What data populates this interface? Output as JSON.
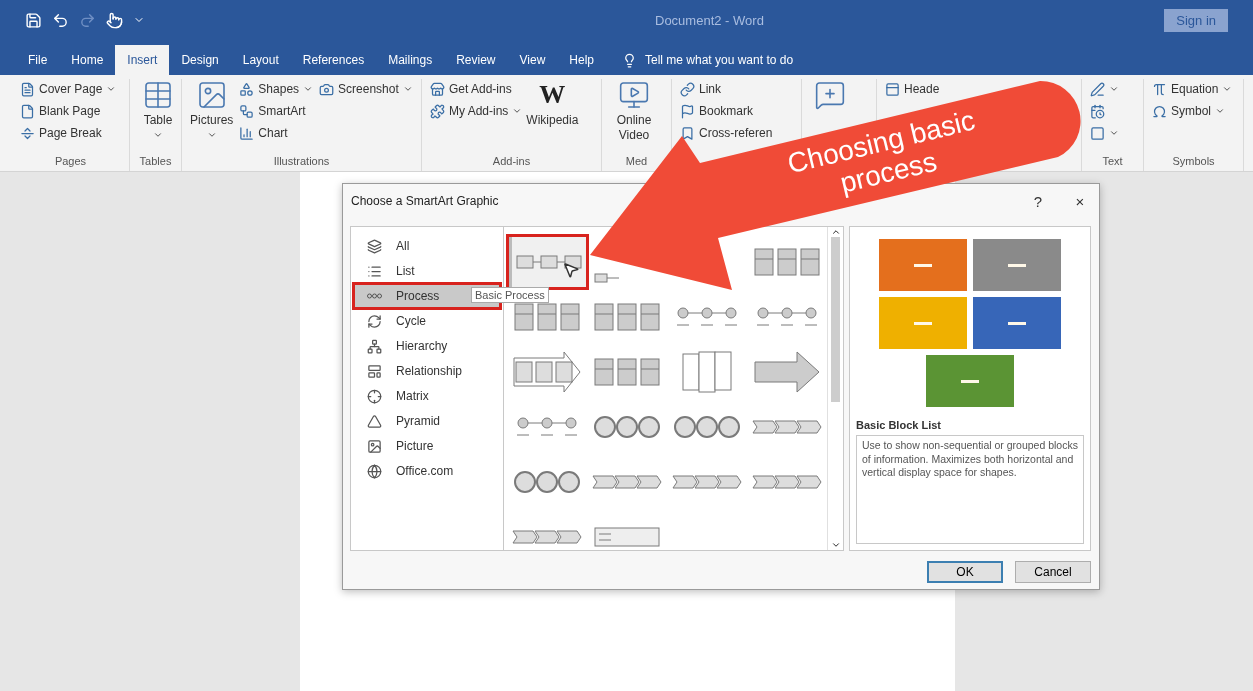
{
  "window": {
    "title": "Document2 - Word",
    "sign_in": "Sign in"
  },
  "tabs": [
    {
      "label": "File",
      "selected": false
    },
    {
      "label": "Home",
      "selected": false
    },
    {
      "label": "Insert",
      "selected": true
    },
    {
      "label": "Design",
      "selected": false
    },
    {
      "label": "Layout",
      "selected": false
    },
    {
      "label": "References",
      "selected": false
    },
    {
      "label": "Mailings",
      "selected": false
    },
    {
      "label": "Review",
      "selected": false
    },
    {
      "label": "View",
      "selected": false
    },
    {
      "label": "Help",
      "selected": false
    }
  ],
  "tell_me": "Tell me what you want to do",
  "ribbon": {
    "groups": [
      {
        "label": "Pages",
        "items": [
          {
            "kind": "small",
            "label": "Cover Page",
            "dropdown": true
          },
          {
            "kind": "small",
            "label": "Blank Page"
          },
          {
            "kind": "small",
            "label": "Page Break"
          }
        ]
      },
      {
        "label": "Tables",
        "items": [
          {
            "kind": "large",
            "label": "Table",
            "dropdown": true
          }
        ]
      },
      {
        "label": "Illustrations",
        "items": [
          {
            "kind": "large",
            "label": "Pictures",
            "dropdown": true
          },
          {
            "kind": "small",
            "label": "Shapes",
            "dropdown": true
          },
          {
            "kind": "small",
            "label": "SmartArt"
          },
          {
            "kind": "small",
            "label": "Chart"
          },
          {
            "kind": "small",
            "label": "Screenshot",
            "dropdown": true
          }
        ]
      },
      {
        "label": "Add-ins",
        "items": [
          {
            "kind": "small",
            "label": "Get Add-ins"
          },
          {
            "kind": "small",
            "label": "My Add-ins",
            "dropdown": true
          },
          {
            "kind": "logo",
            "logo": "W",
            "label": "Wikipedia"
          }
        ]
      },
      {
        "label": "Med",
        "items": [
          {
            "kind": "large",
            "label": "Online Video"
          }
        ]
      },
      {
        "items": [
          {
            "kind": "small",
            "label": "Link"
          },
          {
            "kind": "small",
            "label": "Bookmark"
          },
          {
            "kind": "small",
            "label": "Cross-referen"
          }
        ]
      },
      {
        "items": [
          {
            "kind": "large"
          }
        ]
      },
      {
        "items": [
          {
            "kind": "small",
            "label": "Heade"
          }
        ]
      },
      {
        "label": "Text",
        "items": [
          {
            "kind": "small",
            "dropdown": true
          },
          {
            "kind": "small"
          },
          {
            "kind": "small",
            "dropdown": true
          }
        ]
      },
      {
        "label": "Symbols",
        "items": [
          {
            "kind": "small",
            "label": "Equation",
            "dropdown": true
          },
          {
            "kind": "small",
            "label": "Symbol",
            "dropdown": true
          }
        ]
      }
    ]
  },
  "dialog": {
    "title": "Choose a SmartArt Graphic",
    "help": "?",
    "close": "×",
    "categories": [
      {
        "label": "All",
        "selected": false,
        "highlighted": false
      },
      {
        "label": "List",
        "selected": false,
        "highlighted": false
      },
      {
        "label": "Process",
        "selected": true,
        "highlighted": true
      },
      {
        "label": "Cycle",
        "selected": false,
        "highlighted": false
      },
      {
        "label": "Hierarchy",
        "selected": false,
        "highlighted": false
      },
      {
        "label": "Relationship",
        "selected": false,
        "highlighted": false
      },
      {
        "label": "Matrix",
        "selected": false,
        "highlighted": false
      },
      {
        "label": "Pyramid",
        "selected": false,
        "highlighted": false
      },
      {
        "label": "Picture",
        "selected": false,
        "highlighted": false
      },
      {
        "label": "Office.com",
        "selected": false,
        "highlighted": false
      }
    ],
    "tooltip": "Basic Process",
    "layouts": [
      {
        "kind": "process",
        "selected": true,
        "highlighted": true
      },
      {
        "kind": "fragment",
        "selected": false,
        "highlighted": false
      },
      {
        "kind": "stack",
        "selected": false,
        "highlighted": false
      },
      {
        "kind": "stack",
        "selected": false,
        "highlighted": false
      },
      {
        "kind": "stack",
        "selected": false,
        "highlighted": false
      },
      {
        "kind": "dots",
        "selected": false,
        "highlighted": false
      },
      {
        "kind": "dots",
        "selected": false,
        "highlighted": false
      },
      {
        "kind": "arrow-boxes",
        "selected": false,
        "highlighted": false
      },
      {
        "kind": "stack",
        "selected": false,
        "highlighted": false
      },
      {
        "kind": "columns",
        "selected": false,
        "highlighted": false
      },
      {
        "kind": "big-arrow",
        "selected": false,
        "highlighted": false
      },
      {
        "kind": "dots",
        "selected": false,
        "highlighted": false
      },
      {
        "kind": "circles",
        "selected": false,
        "highlighted": false
      },
      {
        "kind": "circles",
        "selected": false,
        "highlighted": false
      },
      {
        "kind": "chevrons",
        "selected": false,
        "highlighted": false
      },
      {
        "kind": "circles",
        "selected": false,
        "highlighted": false
      },
      {
        "kind": "chevrons",
        "selected": false,
        "highlighted": false
      },
      {
        "kind": "chevrons",
        "selected": false,
        "highlighted": false
      },
      {
        "kind": "chevrons",
        "selected": false,
        "highlighted": false
      },
      {
        "kind": "chevrons",
        "selected": false,
        "highlighted": false
      },
      {
        "kind": "accent",
        "selected": false,
        "highlighted": false
      }
    ],
    "preview": {
      "blocks": [
        {
          "color": "#e46f1d"
        },
        {
          "color": "#8a8a8a"
        },
        {
          "color": "#efb000"
        },
        {
          "color": "#3766b8"
        },
        {
          "color": "#5b9434"
        }
      ],
      "name": "Basic Block List",
      "description": "Use to show non-sequential or grouped blocks of information. Maximizes both horizontal and vertical display space for shapes."
    },
    "buttons": [
      {
        "label": "OK",
        "default": true
      },
      {
        "label": "Cancel",
        "default": false
      }
    ]
  },
  "annotation": {
    "text": "Choosing basic process"
  }
}
